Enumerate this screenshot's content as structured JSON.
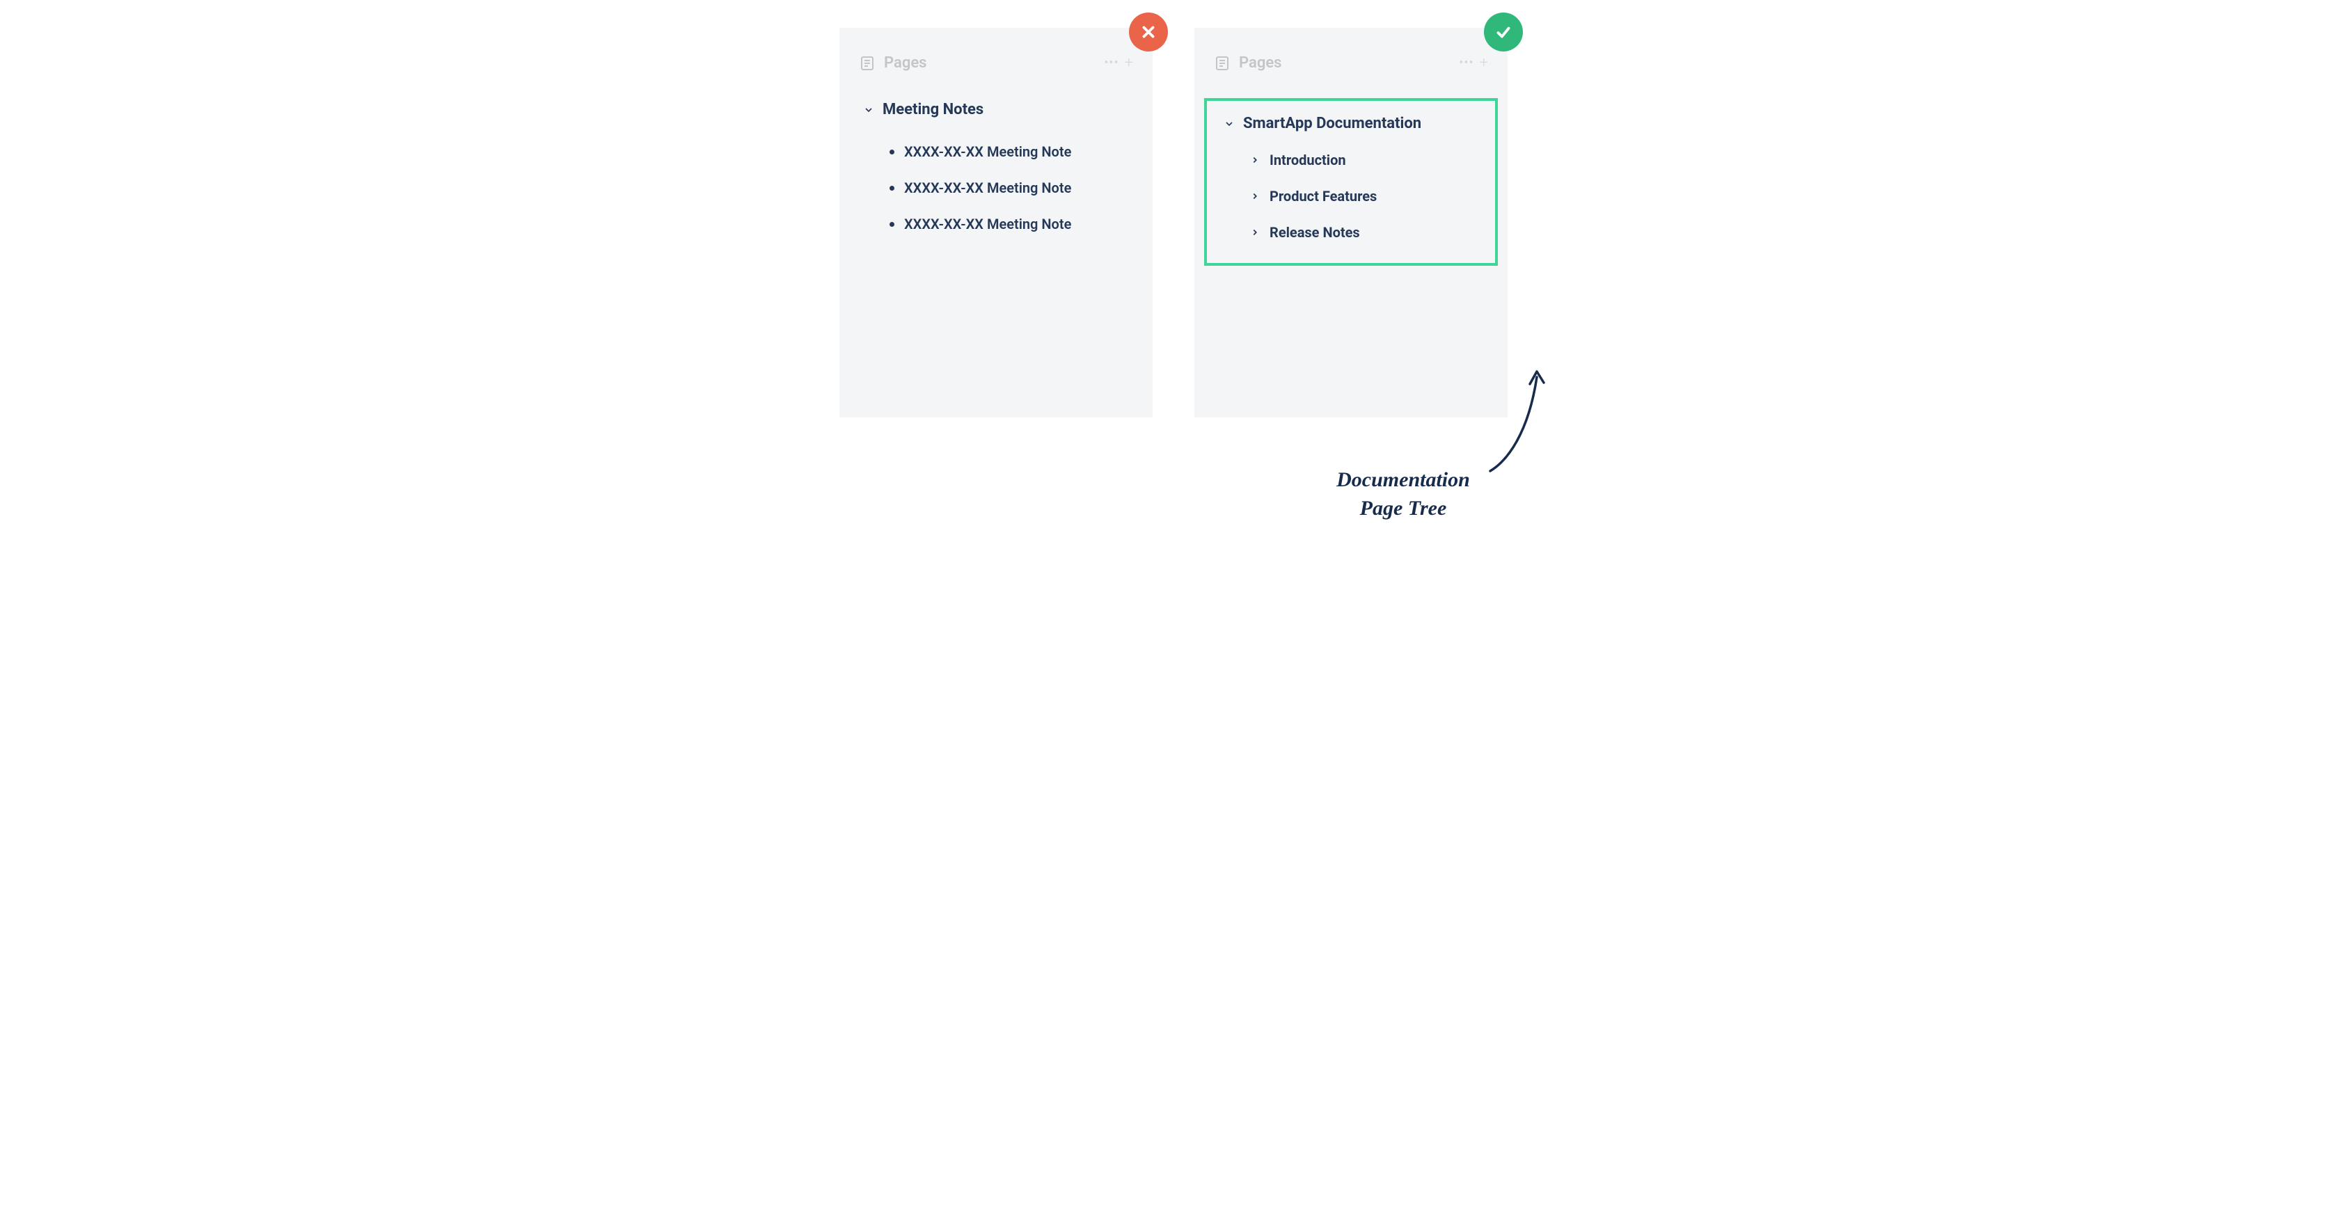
{
  "colors": {
    "bad_badge": "#e96449",
    "good_badge": "#30b87b",
    "highlight_border": "#3dd598",
    "text_primary": "#253858",
    "text_muted": "#c5c5c5",
    "panel_bg": "#f4f5f7"
  },
  "panels": {
    "bad": {
      "title": "Pages",
      "root": "Meeting Notes",
      "items": [
        "XXXX-XX-XX Meeting Note",
        "XXXX-XX-XX Meeting Note",
        "XXXX-XX-XX Meeting Note"
      ]
    },
    "good": {
      "title": "Pages",
      "root": "SmartApp Documentation",
      "items": [
        "Introduction",
        "Product Features",
        "Release Notes"
      ]
    }
  },
  "annotation": "Documentation Page Tree"
}
